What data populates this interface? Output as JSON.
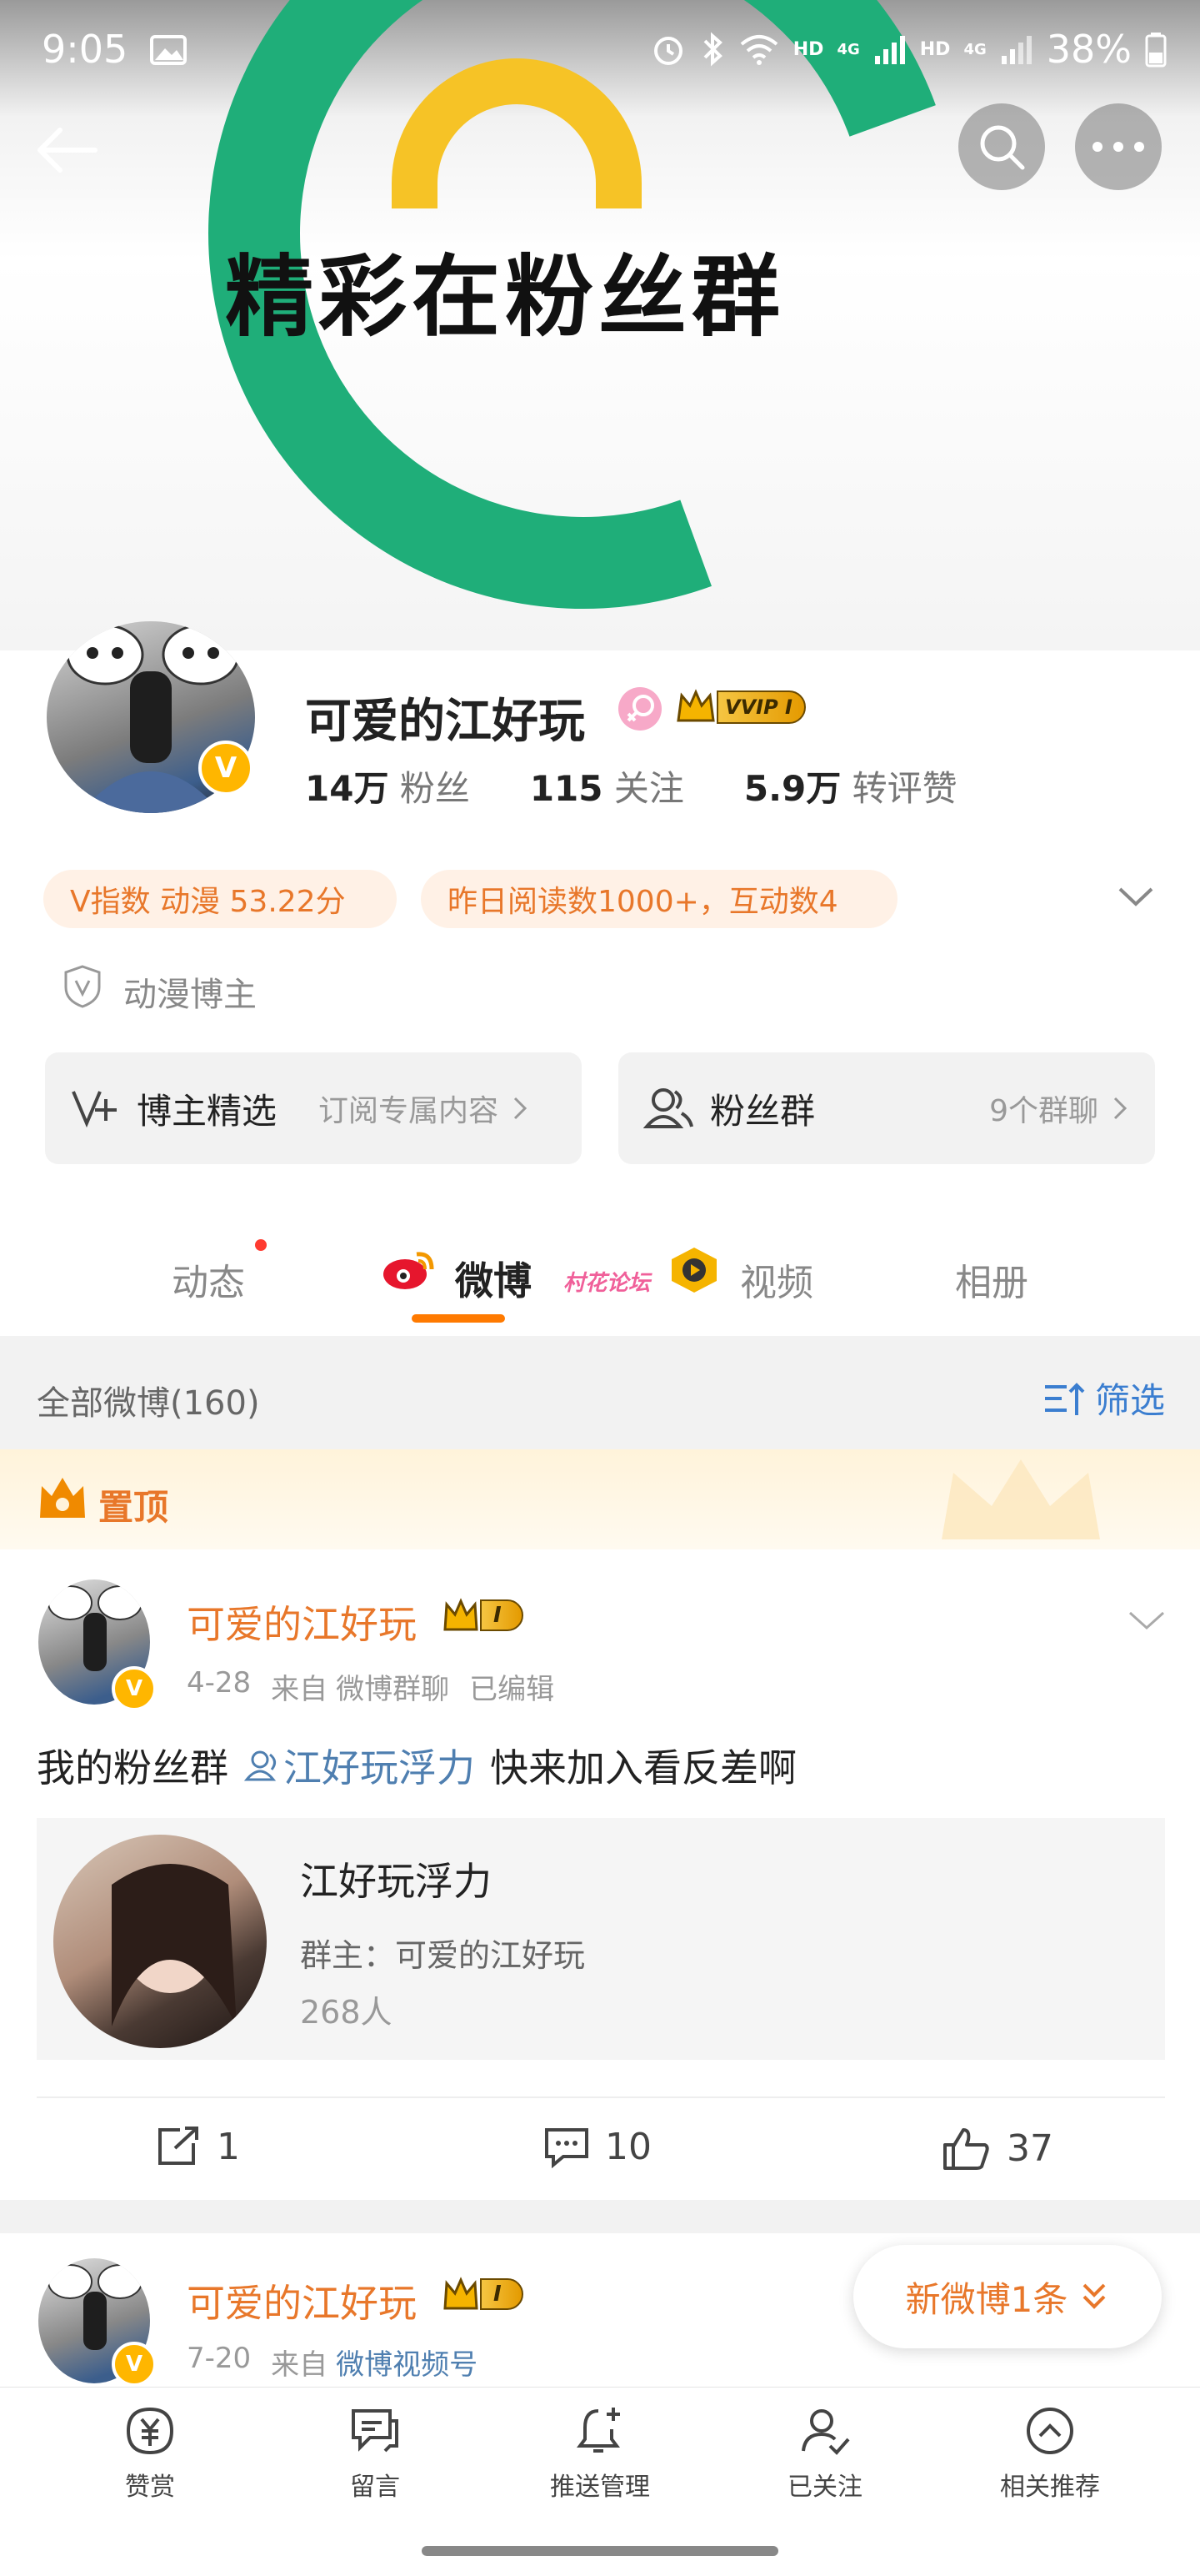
{
  "status_bar": {
    "time": "9:05",
    "battery": "38%",
    "hd1": "HD",
    "hd2": "HD",
    "net1": "4G",
    "net2": "4G"
  },
  "banner": {
    "text": "精彩在粉丝群"
  },
  "profile": {
    "name": "可爱的江好玩",
    "vip": "VVIP I",
    "stats": [
      {
        "num": "14万",
        "label": "粉丝"
      },
      {
        "num": "115",
        "label": "关注"
      },
      {
        "num": "5.9万",
        "label": "转评赞"
      }
    ],
    "pills": [
      "V指数 动漫 53.22分",
      "昨日阅读数1000+，互动数4"
    ],
    "category": "动漫博主",
    "cards": [
      {
        "title": "博主精选",
        "sub": "订阅专属内容"
      },
      {
        "title": "粉丝群",
        "sub": "9个群聊"
      }
    ]
  },
  "tabs": [
    "动态",
    "微博",
    "视频",
    "相册"
  ],
  "watermark": "村花论坛",
  "list_header": {
    "count_label": "全部微博(160)",
    "filter": "筛选"
  },
  "pinned_label": "置顶",
  "posts": [
    {
      "name": "可爱的江好玩",
      "badge": "I",
      "date": "4-28",
      "from": "来自",
      "source": "微博群聊",
      "edited": "已编辑",
      "text_prefix": "我的粉丝群",
      "group_link": "江好玩浮力",
      "text_suffix": "快来加入看反差啊",
      "group_card": {
        "title": "江好玩浮力",
        "owner": "群主：可爱的江好玩",
        "members": "268人"
      },
      "actions": {
        "repost": "1",
        "comment": "10",
        "like": "37"
      }
    },
    {
      "name": "可爱的江好玩",
      "badge": "I",
      "date": "7-20",
      "from": "来自",
      "source": "微博视频号"
    }
  ],
  "new_posts_button": "新微博1条",
  "bottom_nav": [
    "赞赏",
    "留言",
    "推送管理",
    "已关注",
    "相关推荐"
  ]
}
